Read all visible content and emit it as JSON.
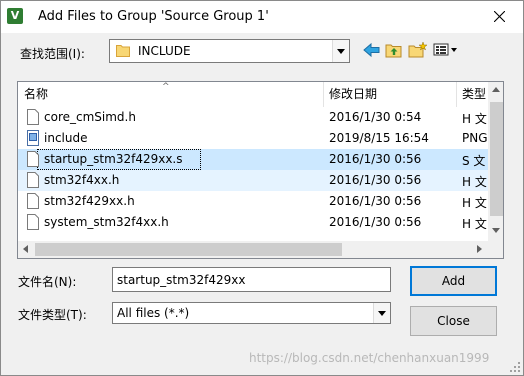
{
  "window": {
    "title": "Add Files to Group 'Source Group 1'",
    "app_icon_letter": "V"
  },
  "look_in": {
    "label": "查找范围(I):",
    "value": "INCLUDE"
  },
  "toolbar": {
    "icons": [
      "back-arrow-icon",
      "up-folder-icon",
      "new-folder-icon",
      "view-menu-icon"
    ]
  },
  "file_list": {
    "columns": {
      "name": "名称",
      "date": "修改日期",
      "type": "类型"
    },
    "rows": [
      {
        "name": "core_cmSimd.h",
        "date": "2016/1/30 0:54",
        "type": "H 文",
        "icon": "document-icon"
      },
      {
        "name": "include",
        "date": "2019/8/15 16:54",
        "type": "PNG",
        "icon": "image-file-icon"
      },
      {
        "name": "startup_stm32f429xx.s",
        "date": "2016/1/30 0:56",
        "type": "S 文",
        "icon": "document-icon"
      },
      {
        "name": "stm32f4xx.h",
        "date": "2016/1/30 0:56",
        "type": "H 文",
        "icon": "document-icon"
      },
      {
        "name": "stm32f429xx.h",
        "date": "2016/1/30 0:56",
        "type": "H 文",
        "icon": "document-icon"
      },
      {
        "name": "system_stm32f4xx.h",
        "date": "2016/1/30 0:56",
        "type": "H 文",
        "icon": "document-icon"
      }
    ],
    "selected_index": 2,
    "hover_index": 3
  },
  "file_name": {
    "label": "文件名(N):",
    "value": "startup_stm32f429xx"
  },
  "file_type": {
    "label": "文件类型(T):",
    "value": "All files (*.*)"
  },
  "buttons": {
    "add": "Add",
    "close": "Close"
  },
  "watermark": "https://blog.csdn.net/chenhanxuan1999",
  "colors": {
    "selection": "#cce8ff",
    "hover": "#e5f3ff",
    "accent": "#0078d7"
  }
}
